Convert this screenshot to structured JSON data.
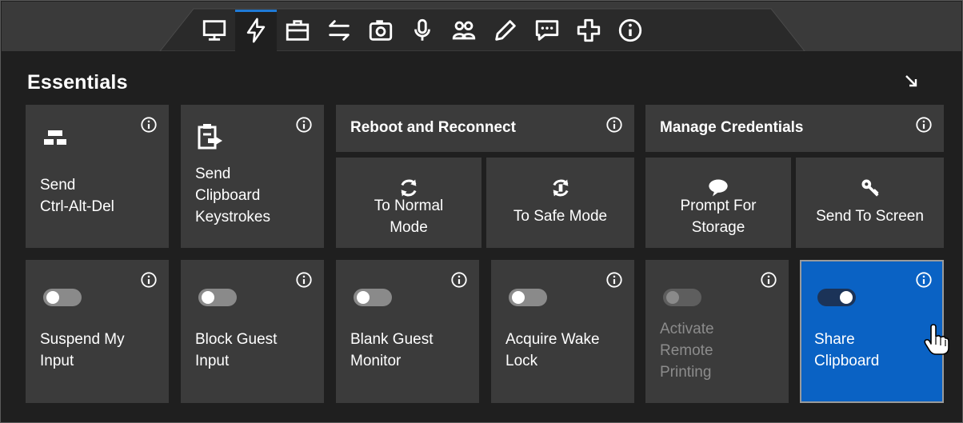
{
  "tabs": [
    {
      "icon": "monitor-icon"
    },
    {
      "icon": "lightning-icon",
      "active": true
    },
    {
      "icon": "toolbox-icon"
    },
    {
      "icon": "transfer-arrows-icon"
    },
    {
      "icon": "camera-icon"
    },
    {
      "icon": "microphone-icon"
    },
    {
      "icon": "users-icon"
    },
    {
      "icon": "pencil-icon"
    },
    {
      "icon": "chat-icon"
    },
    {
      "icon": "plus-icon"
    },
    {
      "icon": "info-icon"
    }
  ],
  "section": {
    "title": "Essentials"
  },
  "actions": {
    "send_cad": "Send\nCtrl-Alt-Del",
    "send_clipboard": "Send\nClipboard\nKeystrokes"
  },
  "reboot": {
    "header": "Reboot and Reconnect",
    "normal": "To Normal\nMode",
    "safe": "To Safe Mode"
  },
  "credentials": {
    "header": "Manage Credentials",
    "prompt": "Prompt For\nStorage",
    "send_to_screen": "Send To Screen"
  },
  "toggles": [
    {
      "label": "Suspend My\nInput",
      "on": false,
      "disabled": false
    },
    {
      "label": "Block Guest\nInput",
      "on": false,
      "disabled": false
    },
    {
      "label": "Blank Guest\nMonitor",
      "on": false,
      "disabled": false
    },
    {
      "label": "Acquire Wake\nLock",
      "on": false,
      "disabled": false
    },
    {
      "label": "Activate\nRemote\nPrinting",
      "on": false,
      "disabled": true
    },
    {
      "label": "Share\nClipboard",
      "on": true,
      "disabled": false
    }
  ],
  "colors": {
    "accent": "#1f7ad6",
    "active_card": "#0a62c4",
    "card": "#3b3b3b",
    "background": "#1f1f1f"
  }
}
